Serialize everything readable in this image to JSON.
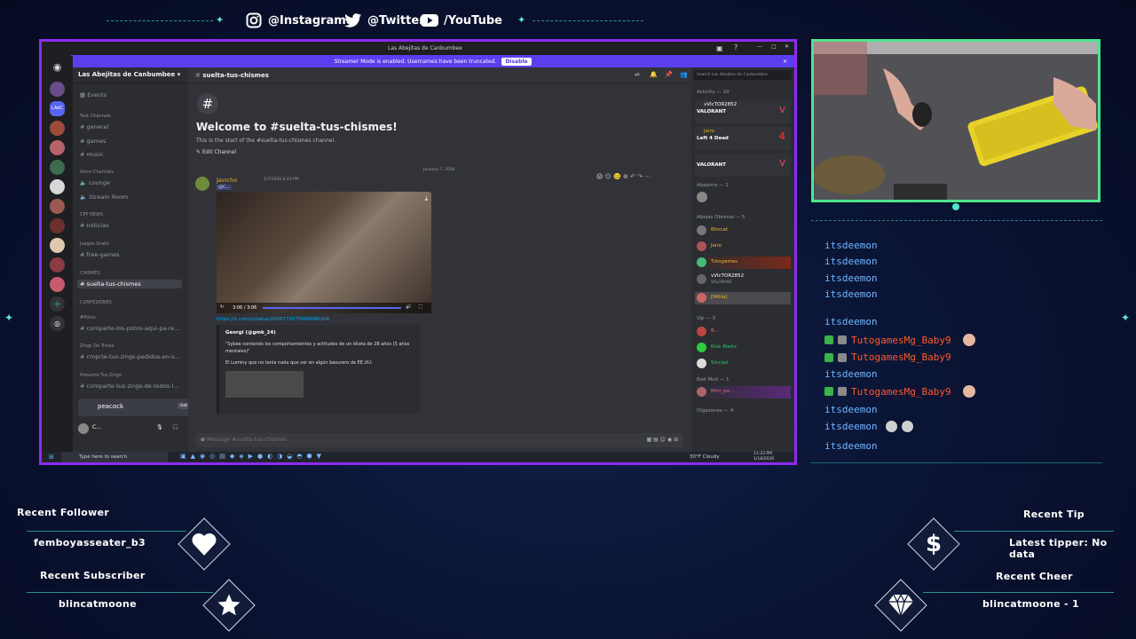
{
  "social": {
    "instagram": "@Instagram",
    "twitter": "@Twitter",
    "youtube": "/YouTube"
  },
  "discord": {
    "window_title": "Las Abejitas de Canbumbee",
    "streamer_banner": "Streamer Mode is enabled. Usernames have been truncated.",
    "streamer_disable": "Disable",
    "server_name": "Las Abejitas de Canbumbee",
    "events": "Events",
    "categories": {
      "text": "Text Channels",
      "voice": "Voice Channels",
      "cpp": "CPP NEWS",
      "juegos": "Juegos Gratis",
      "chismes": "CHISMES",
      "confesiones": "CONFESIONES",
      "potos": "#Potos",
      "zings_troleo": "Zings De Troleo",
      "zings_presume": "Presume Tus Zings"
    },
    "channels": {
      "general": "general",
      "games": "games",
      "music": "music",
      "lounge": "Lounge",
      "stream_room": "Stream Room",
      "noticias": "noticias",
      "free_games": "free-games",
      "suelta": "suelta-tus-chismes",
      "potos": "comparte-los-potos-aqui-pa-re...",
      "zings_troleo": "cmprte-tus-zings-pedidos-en-s...",
      "zings_presume": "comparte-tus-zings-de-todos-l..."
    },
    "channel_header": "suelta-tus-chismes",
    "search_placeholder": "Search Las Abejitas de Canbumbee",
    "welcome_title": "Welcome to #suelta-tus-chismes!",
    "welcome_sub": "This is the start of the #suelta-tus-chismes channel.",
    "edit_channel": "Edit Channel",
    "date_divider": "January 7, 2026",
    "message": {
      "author": "Javicho",
      "timestamp": "1/7/2026 6:23 PM",
      "reply_tag": "@C...",
      "video_time": "3:06 / 3:06",
      "link": "https://x.com/i/status/2008772075666686204",
      "embed_author": "Georgi (@gmk_24)",
      "embed_text1": "\"Sybee contando los comportamientos y actitudes de un idiota de 28 años (5 años mentales)\"",
      "embed_text2": "El Luminy que no tenía nada que ver en algún basurero de EE.UU:"
    },
    "composer_placeholder": "Message #suelta-tus-chismes",
    "peacock": "peacock",
    "peacock_btn": "Get Reward!",
    "user_short": "C...",
    "members": {
      "activity": "Activity — 10",
      "act1_name": "vVIcTOR2852",
      "act1_game": "VALORANT",
      "act2_name": "Jairo",
      "act2_game": "Left 4 Dead",
      "act3_game": "VALORANT",
      "abejorro": "Abejorro — 1",
      "obreras": "Abejas Obreras — 5",
      "m1": "Blincat",
      "m2": "Jairo",
      "m3": "Tutogames",
      "m4": "vVIcTOR2852",
      "m4_sub": "VALORANT",
      "m5": "[Milila]",
      "vip": "Vip — 3",
      "v1": "B...",
      "v2": "Kick Alerts",
      "v3": "Sinclair",
      "badmod": "Bad Mod — 1",
      "bm1": "Mini_pa...",
      "olgazanes": "Olgazanes — 4"
    },
    "taskbar": {
      "search": "Type here to search",
      "weather": "30°F Cloudy",
      "time": "11:33 PM",
      "date": "1/18/2026"
    }
  },
  "chat": [
    {
      "user": "itsdeemon",
      "color": "blue",
      "badges": false
    },
    {
      "user": "itsdeemon",
      "color": "blue",
      "badges": false
    },
    {
      "user": "itsdeemon",
      "color": "blue",
      "badges": false
    },
    {
      "user": "itsdeemon",
      "color": "blue",
      "badges": false
    },
    {
      "user": "itsdeemon",
      "color": "blue",
      "badges": false
    },
    {
      "user": "TutogamesMg_Baby9",
      "color": "red",
      "badges": true
    },
    {
      "user": "TutogamesMg_Baby9",
      "color": "red",
      "badges": true
    },
    {
      "user": "itsdeemon",
      "color": "blue",
      "badges": false
    },
    {
      "user": "TutogamesMg_Baby9",
      "color": "red",
      "badges": true
    },
    {
      "user": "itsdeemon",
      "color": "blue",
      "badges": false
    },
    {
      "user": "itsdeemon",
      "color": "blue",
      "badges": false
    },
    {
      "user": "itsdeemon",
      "color": "blue",
      "badges": false
    }
  ],
  "widgets": {
    "recent_follower_label": "Recent Follower",
    "recent_follower": "femboyasseater_b3",
    "recent_subscriber_label": "Recent Subscriber",
    "recent_subscriber": "blincatmoone",
    "recent_tip_label": "Recent Tip",
    "recent_tip": "Latest tipper: No data",
    "recent_cheer_label": "Recent Cheer",
    "recent_cheer": "blincatmoone - 1"
  },
  "colors": {
    "capture_border": "#8b2cf0",
    "webcam_border": "#4de58b",
    "chat_blue": "#6fb6ff",
    "chat_red": "#ff5a2a"
  }
}
